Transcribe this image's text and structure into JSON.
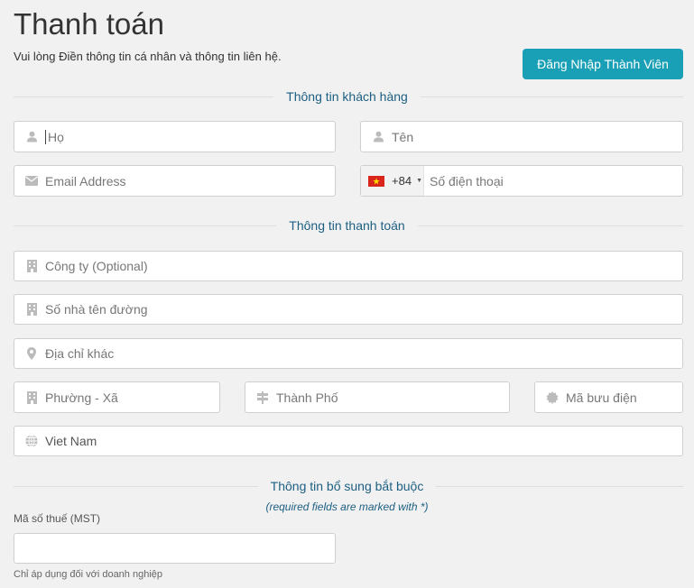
{
  "page": {
    "title": "Thanh toán",
    "subtitle": "Vui lòng Điền thông tin cá nhân và thông tin liên hệ.",
    "login_button": "Đăng Nhập Thành Viên"
  },
  "customer_section": {
    "title": "Thông tin khách hàng",
    "first_name": {
      "placeholder": "Họ",
      "icon": "user-icon"
    },
    "last_name": {
      "placeholder": "Tên",
      "icon": "user-icon"
    },
    "email": {
      "placeholder": "Email Address",
      "icon": "envelope-icon"
    },
    "phone": {
      "country_code": "+84",
      "placeholder": "Số điện thoại",
      "flag": "vietnam-flag-icon"
    }
  },
  "billing_section": {
    "title": "Thông tin thanh toán",
    "company": {
      "placeholder": "Công ty (Optional)",
      "icon": "building-icon"
    },
    "address1": {
      "placeholder": "Số nhà tên đường",
      "icon": "building-icon"
    },
    "address2": {
      "placeholder": "Địa chỉ khác",
      "icon": "map-marker-icon"
    },
    "ward": {
      "placeholder": "Phường - Xã",
      "icon": "building-icon"
    },
    "city": {
      "placeholder": "Thành Phố",
      "icon": "signpost-icon"
    },
    "postcode": {
      "placeholder": "Mã bưu điện",
      "icon": "certificate-icon"
    },
    "country": {
      "value": "Viet Nam",
      "icon": "globe-icon"
    }
  },
  "additional_section": {
    "title": "Thông tin bổ sung bắt buộc",
    "required_note": "(required fields are marked with *)",
    "tax_label": "Mã số thuế (MST)",
    "tax_value": "",
    "tax_hint": "Chỉ áp dụng đối với doanh nghiệp"
  },
  "colors": {
    "accent": "#1aa0b6",
    "section_title": "#1d5f82",
    "background": "#f1f1f1",
    "icon": "#bbbbbb"
  }
}
